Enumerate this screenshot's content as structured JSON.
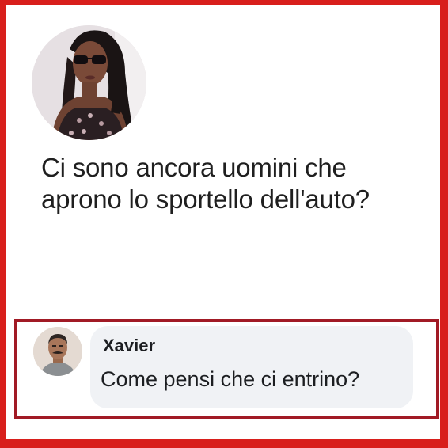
{
  "post": {
    "avatar_icon": "profile-photo-woman-sunglasses",
    "text_line1": "Ci sono ancora uomini che",
    "text_line2": "aprono lo sportello dell'auto?"
  },
  "comment": {
    "avatar_icon": "profile-photo-man-mustache",
    "author": "Xavier",
    "text": "Come pensi che ci entrino?"
  },
  "colors": {
    "frame_border": "#d81f1c",
    "comment_border": "#a11a25",
    "comment_bubble": "#f0f2f5",
    "text": "#1f1f1f"
  }
}
